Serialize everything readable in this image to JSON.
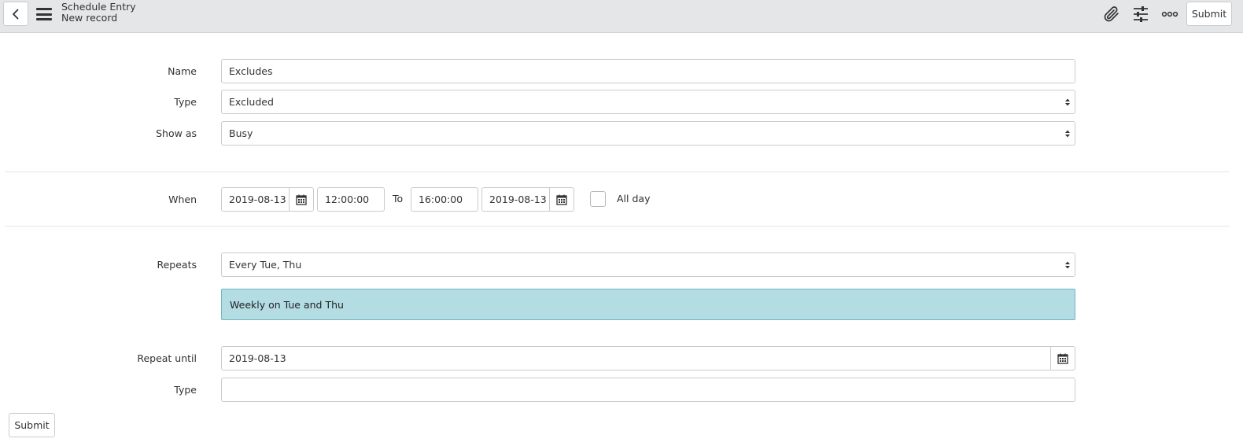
{
  "header": {
    "title": "Schedule Entry",
    "subtitle": "New record",
    "submit_label": "Submit"
  },
  "icons": {
    "back": "chevron-left-icon",
    "menu": "hamburger-menu-icon",
    "attachment": "paperclip-icon",
    "settings": "sliders-icon",
    "more": "more-options-icon",
    "calendar": "calendar-icon"
  },
  "form": {
    "name": {
      "label": "Name",
      "value": "Excludes"
    },
    "type": {
      "label": "Type",
      "value": "Excluded"
    },
    "show_as": {
      "label": "Show as",
      "value": "Busy"
    },
    "when": {
      "label": "When",
      "start_date": "2019-08-13",
      "start_time": "12:00:00",
      "to_label": "To",
      "end_time": "16:00:00",
      "end_date": "2019-08-13",
      "all_day_label": "All day",
      "all_day_checked": false
    },
    "repeats": {
      "label": "Repeats",
      "value": "Every Tue, Thu",
      "summary": "Weekly on Tue and Thu"
    },
    "repeat_until": {
      "label": "Repeat until",
      "value": "2019-08-13"
    },
    "type2": {
      "label": "Type",
      "value": ""
    }
  },
  "footer": {
    "submit_label": "Submit"
  },
  "colors": {
    "header_bg": "#e4e6e7",
    "info_bg": "#b3dce3",
    "info_border": "#74b5c1"
  }
}
